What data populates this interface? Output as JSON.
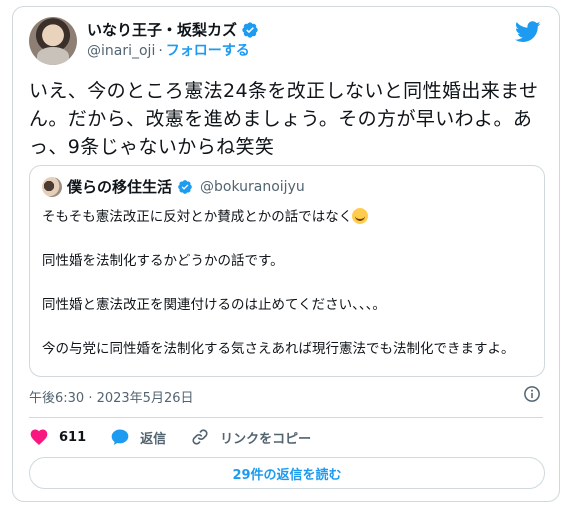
{
  "author": {
    "display_name": "いなり王子・坂梨カズ",
    "handle": "@inari_oji",
    "separator": "·",
    "follow_label": "フォローする"
  },
  "tweet": {
    "text": "いえ、今のところ憲法24条を改正しないと同性婚出来ません。だから、改憲を進めましょう。その方が早いわよ。あっ、9条じゃないからね笑笑",
    "timestamp": "午後6:30 · 2023年5月26日"
  },
  "quote": {
    "display_name": "僕らの移住生活",
    "handle": "@bokuranoijyu",
    "lines": [
      "そもそも憲法改正に反対とか賛成とかの話ではなく",
      "同性婚を法制化するかどうかの話です。",
      "同性婚と憲法改正を関連付けるのは止めてください、、、。",
      "今の与党に同性婚を法制化する気さえあれば現行憲法でも法制化できますよ。"
    ]
  },
  "actions": {
    "likes": "611",
    "reply_label": "返信",
    "copy_link_label": "リンクをコピー"
  },
  "replies_button": "29件の返信を読む",
  "colors": {
    "accent": "#1d9bf0",
    "like": "#f91880",
    "border": "#cfd9de",
    "muted": "#536471"
  },
  "icons": [
    "verified-badge-icon",
    "twitter-bird-icon",
    "info-icon",
    "heart-icon",
    "reply-icon",
    "link-icon",
    "emoji-icon"
  ]
}
